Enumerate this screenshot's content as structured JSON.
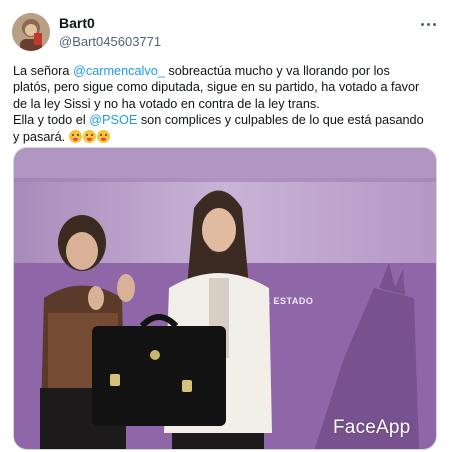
{
  "tweet": {
    "author": {
      "display_name": "Bart0",
      "handle": "@Bart045603771",
      "avatar_icon": "avatar-photo"
    },
    "more_icon": "more-options-icon",
    "text": {
      "line1": {
        "before": "La señora ",
        "mention": "@carmencalvo_",
        "after": " sobreactúa mucho y va llorando por los"
      },
      "line2": "platós, pero sigue como diputada, sigue en su partido, ha votado a favor",
      "line3": "de la ley Sissi y no ha votado en contra de la ley trans.",
      "line4": {
        "before": "Ella y todo el ",
        "mention": "@PSOE",
        "after": " son complices y culpables de lo que está pasando"
      },
      "line5": "y pasará.",
      "emojis": [
        "zany-face-emoji",
        "zany-face-emoji",
        "zany-face-emoji"
      ]
    },
    "media": {
      "watermark": "FaceApp",
      "backdrop_text": "DE ESTADO",
      "colors": {
        "backdrop_light": "#cdb6d9",
        "backdrop_dark": "#8a5fa3"
      }
    }
  },
  "colors": {
    "mention": "#1d9bf0",
    "text": "#0f1419",
    "secondary": "#536471"
  }
}
